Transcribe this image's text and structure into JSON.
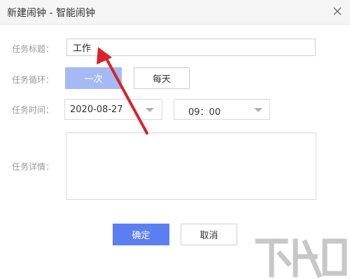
{
  "window": {
    "title": "新建闹钟 - 智能闹钟"
  },
  "form": {
    "title_label": "任务标题：",
    "title_value": "工作",
    "repeat_label": "任务循环：",
    "repeat_options": [
      "一次",
      "每天"
    ],
    "repeat_selected": "一次",
    "time_label": "任务时间：",
    "date_value": "2020-08-27",
    "time_value": "09：00",
    "detail_label": "任务详情：",
    "detail_value": ""
  },
  "buttons": {
    "ok": "确定",
    "cancel": "取消"
  },
  "colors": {
    "primary": "#5b7ef0",
    "selected_segment": "#a5b9f4",
    "annotation_arrow": "#d9232a"
  },
  "icons": {
    "close": "close-icon",
    "dropdown": "chevron-down-icon"
  }
}
